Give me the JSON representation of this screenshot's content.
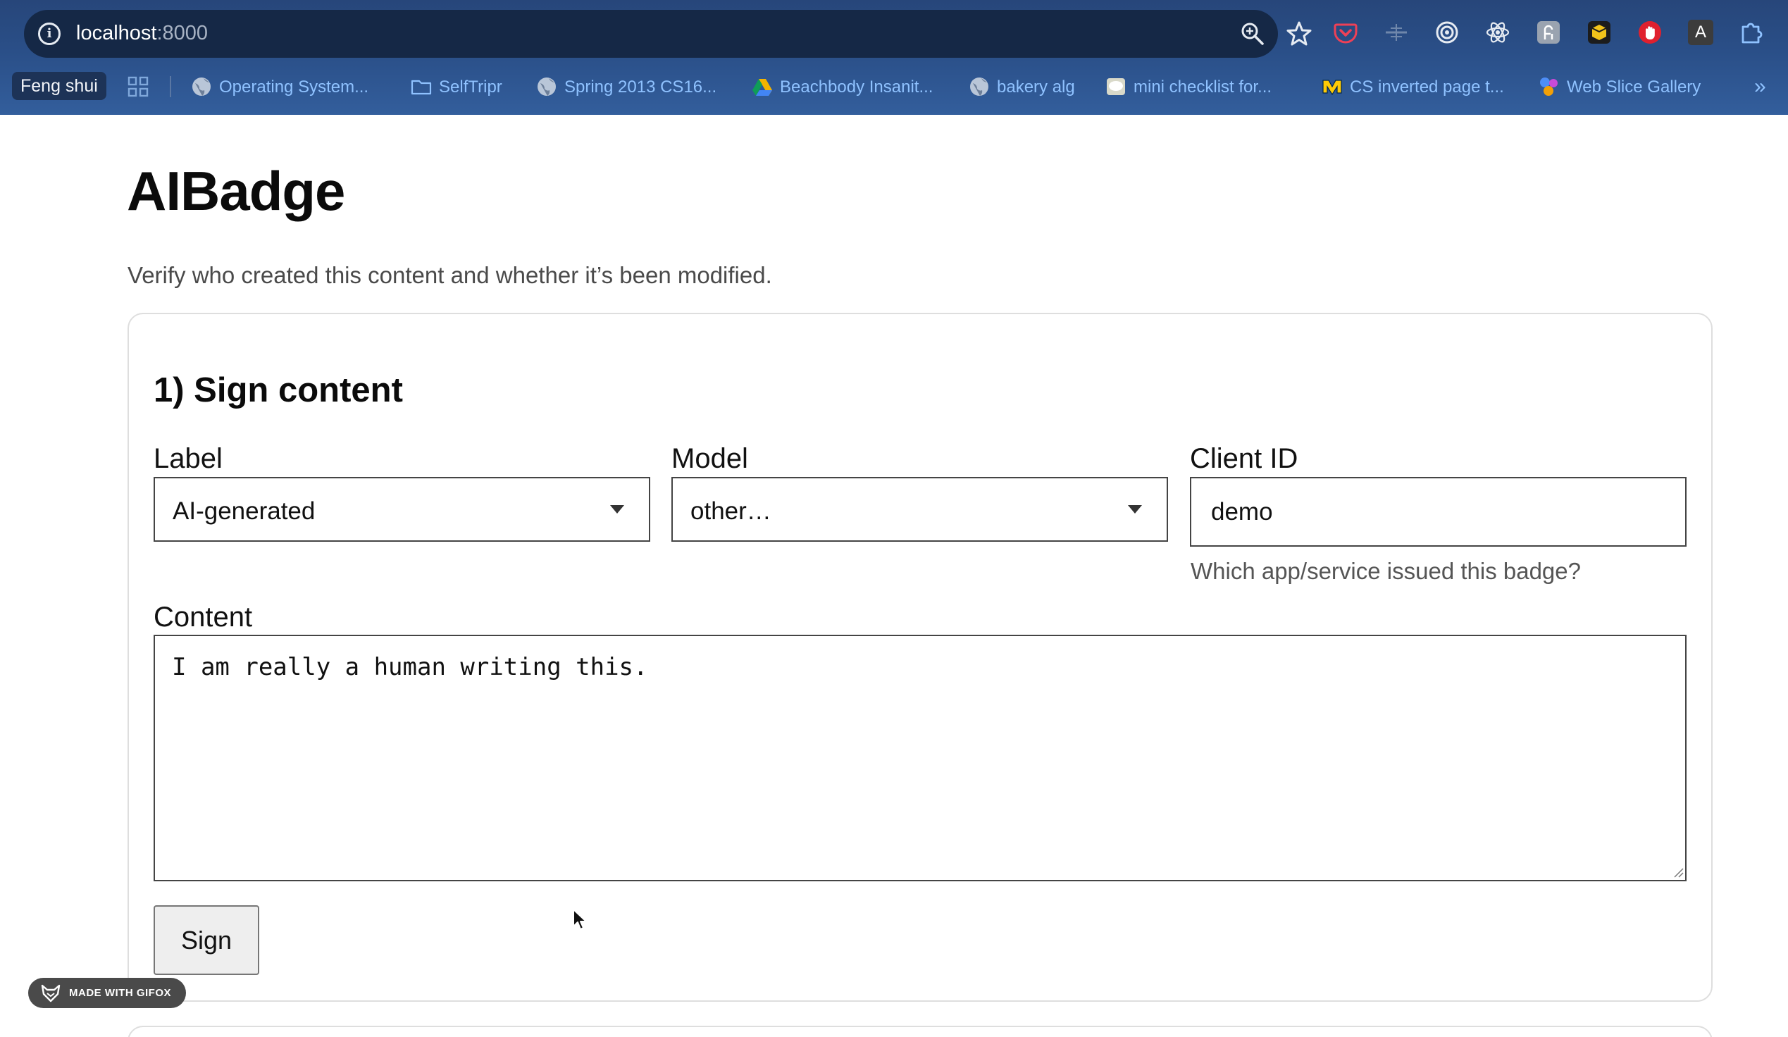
{
  "browser": {
    "url_host": "localhost",
    "url_port": ":8000",
    "bookmarks_pill": "Feng shui",
    "bookmarks": [
      "Operating System...",
      "SelfTripr",
      "Spring 2013 CS16...",
      "Beachbody Insanit...",
      "bakery alg",
      "mini checklist for...",
      "CS inverted page t...",
      "Web Slice Gallery"
    ],
    "extension_icon_letter_a": "A",
    "more_label": "»"
  },
  "page": {
    "title": "AIBadge",
    "subtitle": "Verify who created this content and whether it’s been modified."
  },
  "sign": {
    "section_title": "1) Sign content",
    "label_field": {
      "label": "Label",
      "value": "AI-generated"
    },
    "model_field": {
      "label": "Model",
      "value": "other…"
    },
    "client_field": {
      "label": "Client ID",
      "value": "demo",
      "help": "Which app/service issued this badge?"
    },
    "content_field": {
      "label": "Content",
      "value": "I am really a human writing this."
    },
    "button_label": "Sign"
  },
  "overlay": {
    "gifox_label": "MADE WITH GIFOX"
  }
}
